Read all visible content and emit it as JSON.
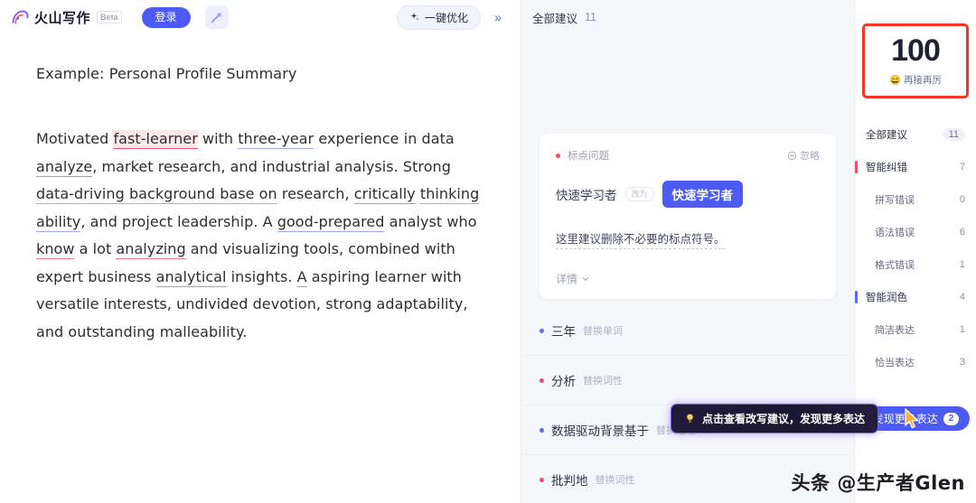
{
  "header": {
    "brand_name": "火山写作",
    "beta_label": "Beta",
    "login_label": "登录",
    "wand_icon": "magic-wand-icon",
    "optimize_label": "一键优化",
    "sparkle_icon": "sparkle-icon",
    "collapse_icon": "»"
  },
  "document": {
    "title": "Example: Personal Profile Summary",
    "paragraph": {
      "l1_a": "Motivated ",
      "l1_err": "fast-learner",
      "l1_b": " with ",
      "l1_u1": "three-year",
      "l1_c": " experience in data",
      "l2_u1": "analyze",
      "l2_a": ", market research, and industrial analysis. Strong",
      "l3_u1": "data-driving background base on",
      "l3_a": " research, ",
      "l3_u2": "critically",
      "l4_u1": "thinking ability",
      "l4_a": ", and project leadership. A ",
      "l4_u2": "good-prepared",
      "l5_a": "analyst who ",
      "l5_u1": "know",
      "l5_b": " a lot ",
      "l5_u2": "analyzing",
      "l5_c": " and visualizing tools,",
      "l6_a": "combined with expert business ",
      "l6_u1": "analytical",
      "l6_b": " insights. ",
      "l6_u2": "A",
      "l7": "aspiring learner with versatile interests, undivided devotion,",
      "l8": "strong adaptability, and outstanding malleability."
    }
  },
  "suggestions_panel": {
    "header_title": "全部建议",
    "header_count": "11",
    "card": {
      "tag": "标点问题",
      "ignore_label": "忽略",
      "ignore_icon": "minus-circle-icon",
      "original_word": "快速学习者",
      "arrow_label": "改为",
      "new_word": "快速学习者",
      "description": "这里建议删除不必要的标点符号。",
      "more_label": "详情",
      "more_icon": "chevron-down-icon"
    },
    "items": [
      {
        "word": "三年",
        "type": "替换单词",
        "dot": "blue"
      },
      {
        "word": "分析",
        "type": "替换词性",
        "dot": "red"
      },
      {
        "word": "数据驱动背景基于",
        "type": "替换短语",
        "dot": "blue"
      },
      {
        "word": "批判地",
        "type": "替换词性",
        "dot": "red"
      }
    ],
    "tooltip": {
      "icon": "lightbulb-icon",
      "text": "点击查看改写建议，发现更多表达"
    }
  },
  "score_panel": {
    "score": "100",
    "score_emoji": "😄",
    "score_caption": "再接再厉",
    "categories": [
      {
        "label": "全部建议",
        "count": "11",
        "marker": "none",
        "level": "header"
      },
      {
        "label": "智能纠错",
        "count": "7",
        "marker": "red",
        "level": "header"
      },
      {
        "label": "拼写错误",
        "count": "0",
        "marker": "none",
        "level": "sub"
      },
      {
        "label": "语法错误",
        "count": "6",
        "marker": "none",
        "level": "sub"
      },
      {
        "label": "格式错误",
        "count": "1",
        "marker": "none",
        "level": "sub"
      },
      {
        "label": "智能润色",
        "count": "4",
        "marker": "blue",
        "level": "header"
      },
      {
        "label": "简洁表达",
        "count": "1",
        "marker": "none",
        "level": "sub"
      },
      {
        "label": "恰当表达",
        "count": "3",
        "marker": "none",
        "level": "sub"
      }
    ],
    "discover_label": "发现更多表达",
    "discover_badge": "2"
  },
  "watermark": "头条 @生产者Glen",
  "colors": {
    "accent_blue": "#4C5BF5",
    "error_red": "#ef4e62",
    "highlight_box": "#f5342c",
    "panel_bg": "#f6f7fb"
  }
}
